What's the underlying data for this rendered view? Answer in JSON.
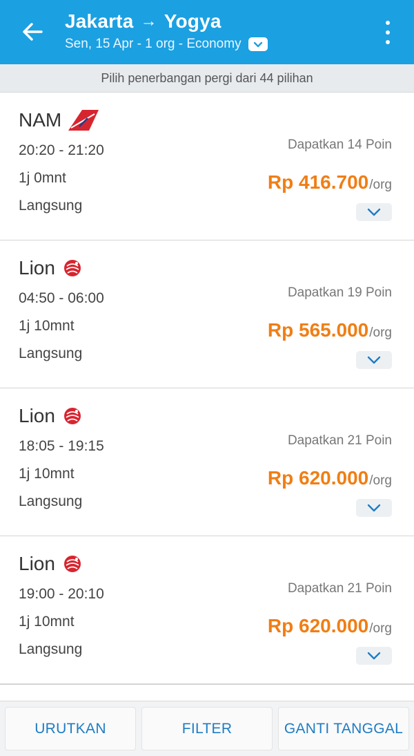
{
  "header": {
    "origin": "Jakarta",
    "arrow": "→",
    "destination": "Yogya",
    "subtitle": "Sen, 15 Apr - 1 org - Economy"
  },
  "info_bar": {
    "text": "Pilih penerbangan pergi dari 44 pilihan"
  },
  "flights": [
    {
      "airline": "NAM",
      "logo": "nam-air-logo",
      "time": "20:20 - 21:20",
      "duration": "1j 0mnt",
      "stops": "Langsung",
      "points": "Dapatkan 14 Poin",
      "price": "Rp 416.700",
      "per": "/org"
    },
    {
      "airline": "Lion",
      "logo": "lion-air-logo",
      "time": "04:50 - 06:00",
      "duration": "1j 10mnt",
      "stops": "Langsung",
      "points": "Dapatkan 19 Poin",
      "price": "Rp 565.000",
      "per": "/org"
    },
    {
      "airline": "Lion",
      "logo": "lion-air-logo",
      "time": "18:05 - 19:15",
      "duration": "1j 10mnt",
      "stops": "Langsung",
      "points": "Dapatkan 21 Poin",
      "price": "Rp 620.000",
      "per": "/org"
    },
    {
      "airline": "Lion",
      "logo": "lion-air-logo",
      "time": "19:00 - 20:10",
      "duration": "1j 10mnt",
      "stops": "Langsung",
      "points": "Dapatkan 21 Poin",
      "price": "Rp 620.000",
      "per": "/org"
    }
  ],
  "bottom_bar": {
    "sort_label": "URUTKAN",
    "filter_label": "FILTER",
    "change_date_label": "GANTI TANGGAL"
  },
  "colors": {
    "header_bg": "#1ba0e2",
    "price": "#f07e14",
    "action_text": "#1e7cc4",
    "airline_logo_red": "#d7252f"
  }
}
